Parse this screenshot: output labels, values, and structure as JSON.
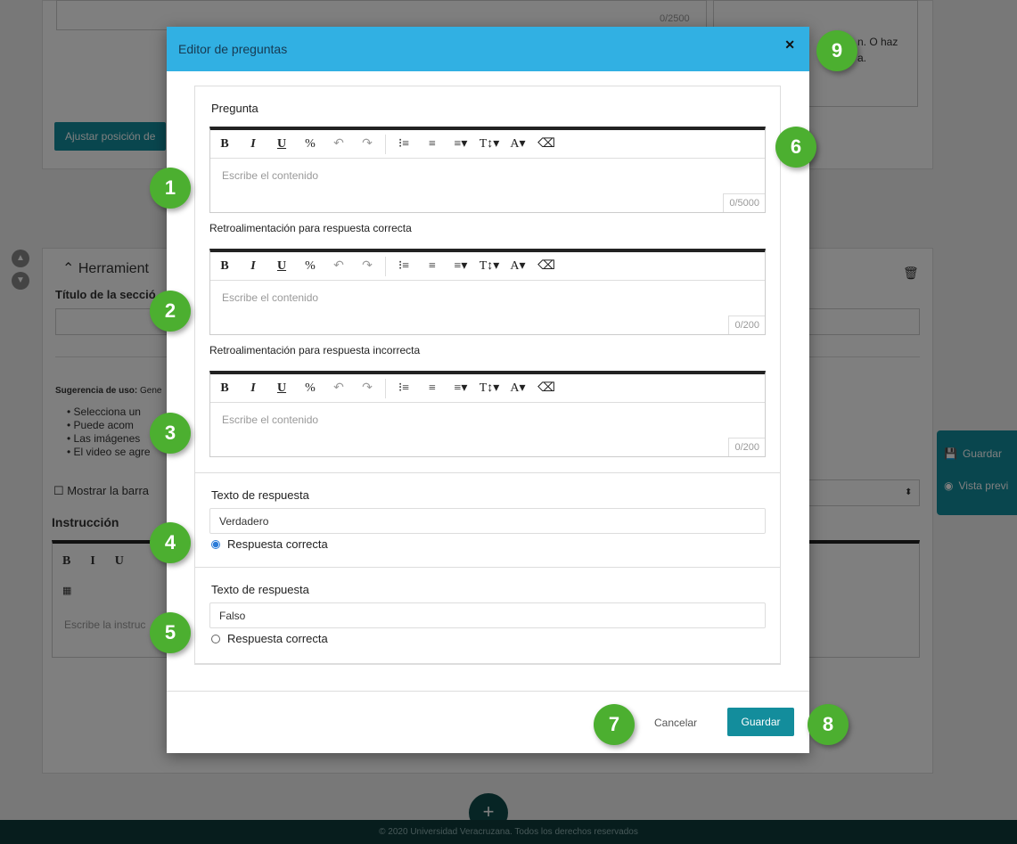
{
  "background": {
    "counter_top": "0/2500",
    "upload_hint": "n. O haz",
    "upload_hint2": "a.",
    "adjust_button": "Ajustar posición de",
    "section_title": "Herramient",
    "section_field_label": "Título de la secció",
    "usage_hint_bold": "Sugerencia de uso:",
    "usage_hint_rest": "Gene",
    "bullets": [
      "Selecciona un",
      "Puede acom",
      "Las imágenes",
      "El video se agre"
    ],
    "checkbox_label": "Mostrar la barra",
    "instruction_label": "Instrucción",
    "instruction_placeholder": "Escribe la instruc",
    "side_save": "Guardar",
    "side_preview": "Vista previ",
    "footer": "© 2020 Universidad Veracruzana. Todos los derechos reservados",
    "fab": "+"
  },
  "modal": {
    "title": "Editor de preguntas",
    "close": "✕",
    "question_label": "Pregunta",
    "question_placeholder": "Escribe el contenido",
    "question_counter": "0/5000",
    "correct_feedback_label": "Retroalimentación para respuesta correcta",
    "correct_feedback_placeholder": "Escribe el contenido",
    "correct_feedback_counter": "0/200",
    "incorrect_feedback_label": "Retroalimentación para respuesta incorrecta",
    "incorrect_feedback_placeholder": "Escribe el contenido",
    "incorrect_feedback_counter": "0/200",
    "toolbar": {
      "bold": "B",
      "italic": "I",
      "underline": "U",
      "link": "%",
      "undo": "↶",
      "redo": "↷",
      "ordered_list": "⁝≡",
      "unordered_list": "≡",
      "align": "≡▾",
      "text_size": "T↕▾",
      "font_color": "A▾",
      "clear_format": "⌫"
    },
    "answers": [
      {
        "label": "Texto de respuesta",
        "value": "Verdadero",
        "radio_label": "Respuesta correcta",
        "checked": true
      },
      {
        "label": "Texto de respuesta",
        "value": "Falso",
        "radio_label": "Respuesta correcta",
        "checked": false
      }
    ],
    "cancel": "Cancelar",
    "save": "Guardar"
  },
  "callouts": [
    "1",
    "2",
    "3",
    "4",
    "5",
    "6",
    "7",
    "8",
    "9"
  ],
  "colors": {
    "header": "#31b0e3",
    "primary": "#138d9c",
    "badge": "#4caf30",
    "footer": "#0e3b3b"
  }
}
